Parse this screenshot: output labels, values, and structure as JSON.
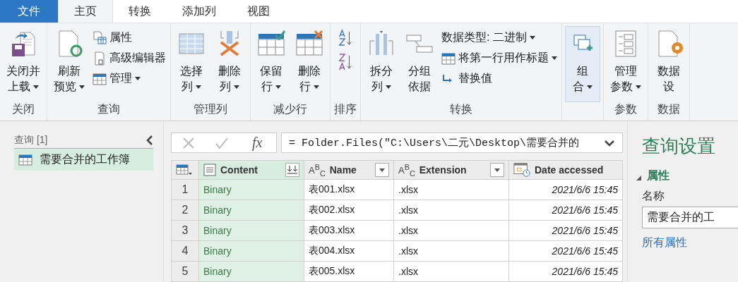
{
  "menu_tabs": [
    {
      "label": "文件",
      "kind": "file",
      "selected": false
    },
    {
      "label": "主页",
      "kind": "tab",
      "selected": true
    },
    {
      "label": "转换",
      "kind": "tab",
      "selected": false
    },
    {
      "label": "添加列",
      "kind": "tab",
      "selected": false
    },
    {
      "label": "视图",
      "kind": "tab",
      "selected": false
    }
  ],
  "ribbon_groups": [
    {
      "label": "关闭",
      "items": [
        {
          "kind": "large",
          "lines": [
            "关闭并",
            "上载"
          ],
          "dropdown": true,
          "highlighted": false
        }
      ]
    },
    {
      "label": "查询",
      "items": [
        {
          "kind": "large",
          "lines": [
            "刷新",
            "预览"
          ],
          "dropdown": true,
          "highlighted": false
        },
        {
          "kind": "stack",
          "rows": [
            {
              "label": "属性",
              "dropdown": false
            },
            {
              "label": "高级编辑器",
              "dropdown": false
            },
            {
              "label": "管理",
              "dropdown": true
            }
          ]
        }
      ]
    },
    {
      "label": "管理列",
      "items": [
        {
          "kind": "large",
          "lines": [
            "选择",
            "列"
          ],
          "dropdown": true,
          "highlighted": false
        },
        {
          "kind": "large",
          "lines": [
            "删除",
            "列"
          ],
          "dropdown": true,
          "highlighted": false
        }
      ]
    },
    {
      "label": "减少行",
      "items": [
        {
          "kind": "large",
          "lines": [
            "保留",
            "行"
          ],
          "dropdown": true,
          "highlighted": false
        },
        {
          "kind": "large",
          "lines": [
            "删除",
            "行"
          ],
          "dropdown": true,
          "highlighted": false
        }
      ]
    },
    {
      "label": "排序",
      "items": [
        {
          "kind": "sort"
        }
      ]
    },
    {
      "label": "转换",
      "items": [
        {
          "kind": "large",
          "lines": [
            "拆分",
            "列"
          ],
          "dropdown": true,
          "highlighted": false
        },
        {
          "kind": "large",
          "lines": [
            "分组",
            "依据"
          ],
          "dropdown": false,
          "highlighted": false
        },
        {
          "kind": "stack",
          "rows": [
            {
              "label": "数据类型: 二进制",
              "dropdown": true
            },
            {
              "label": "将第一行用作标题",
              "dropdown": true
            },
            {
              "label": "替换值",
              "dropdown": false
            }
          ]
        }
      ]
    },
    {
      "items": [
        {
          "kind": "large",
          "lines": [
            "组",
            "合"
          ],
          "dropdown": true,
          "highlighted": true
        }
      ]
    },
    {
      "label": "参数",
      "items": [
        {
          "kind": "large",
          "lines": [
            "管理",
            "参数"
          ],
          "dropdown": true,
          "highlighted": false
        }
      ]
    },
    {
      "label": "数据",
      "items": [
        {
          "kind": "large",
          "lines": [
            "数据",
            "设"
          ],
          "dropdown": false,
          "highlighted": false
        }
      ]
    }
  ],
  "queries_panel": {
    "title": "查询",
    "count": "[1]",
    "items": [
      {
        "label": "需要合并的工作簿",
        "selected": true
      }
    ]
  },
  "formula_bar": {
    "fx": "fx",
    "formula": "= Folder.Files(\"C:\\Users\\二元\\Desktop\\需要合并的"
  },
  "table": {
    "columns": [
      {
        "name": "Content",
        "kind": "binary",
        "selected": true
      },
      {
        "name": "Name",
        "kind": "text",
        "type_label": "A$^{B}$$_{C}$",
        "selected": false
      },
      {
        "name": "Extension",
        "kind": "text",
        "type_label": "A$^{B}$$_{C}$",
        "selected": false
      },
      {
        "name": "Date accessed",
        "kind": "datetime",
        "selected": false
      }
    ],
    "rows": [
      {
        "number": "1",
        "cells": [
          "Binary",
          "表001.xlsx",
          ".xlsx",
          "2021/6/6 15:45"
        ]
      },
      {
        "number": "2",
        "cells": [
          "Binary",
          "表002.xlsx",
          ".xlsx",
          "2021/6/6 15:45"
        ]
      },
      {
        "number": "3",
        "cells": [
          "Binary",
          "表003.xlsx",
          ".xlsx",
          "2021/6/6 15:45"
        ]
      },
      {
        "number": "4",
        "cells": [
          "Binary",
          "表004.xlsx",
          ".xlsx",
          "2021/6/6 15:45"
        ]
      },
      {
        "number": "5",
        "cells": [
          "Binary",
          "表005.xlsx",
          ".xlsx",
          "2021/6/6 15:45"
        ]
      }
    ]
  },
  "query_settings": {
    "title": "查询设置",
    "section": "属性",
    "expanded": true,
    "name_label": "名称",
    "name_value": "需要合并的工",
    "link": "所有属性"
  }
}
